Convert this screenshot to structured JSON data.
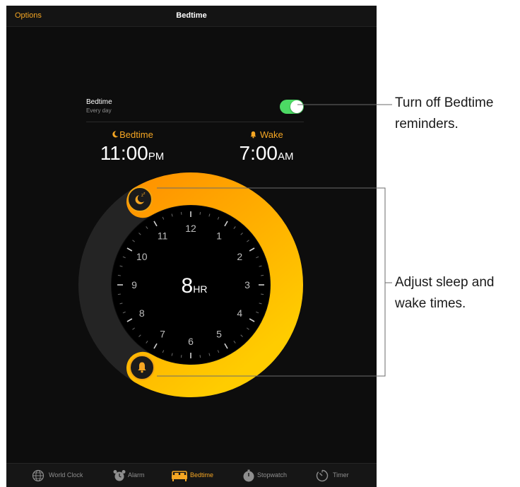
{
  "navbar": {
    "left_label": "Options",
    "title": "Bedtime"
  },
  "setting": {
    "title": "Bedtime",
    "subtitle": "Every day",
    "toggle_on": true
  },
  "bedtime": {
    "label": "Bedtime",
    "time": "11:00",
    "suffix": "PM"
  },
  "wake": {
    "label": "Wake",
    "time": "7:00",
    "suffix": "AM"
  },
  "dial": {
    "numbers": [
      "12",
      "1",
      "2",
      "3",
      "4",
      "5",
      "6",
      "7",
      "8",
      "9",
      "10",
      "11"
    ],
    "duration": "8",
    "duration_unit": "HR"
  },
  "tabs": [
    {
      "label": "World Clock",
      "icon": "globe-icon",
      "active": false
    },
    {
      "label": "Alarm",
      "icon": "alarm-clock-icon",
      "active": false
    },
    {
      "label": "Bedtime",
      "icon": "bed-icon",
      "active": true
    },
    {
      "label": "Stopwatch",
      "icon": "stopwatch-icon",
      "active": false
    },
    {
      "label": "Timer",
      "icon": "timer-icon",
      "active": false
    }
  ],
  "callouts": {
    "toggle": [
      "Turn off Bedtime",
      "reminders."
    ],
    "dial": [
      "Adjust sleep and",
      "wake times."
    ]
  },
  "colors": {
    "accent": "#f5a623",
    "ring_start": "#ff9500",
    "ring_end": "#ffcc00",
    "toggle_on": "#4cd964",
    "background": "#0d0d0d"
  }
}
